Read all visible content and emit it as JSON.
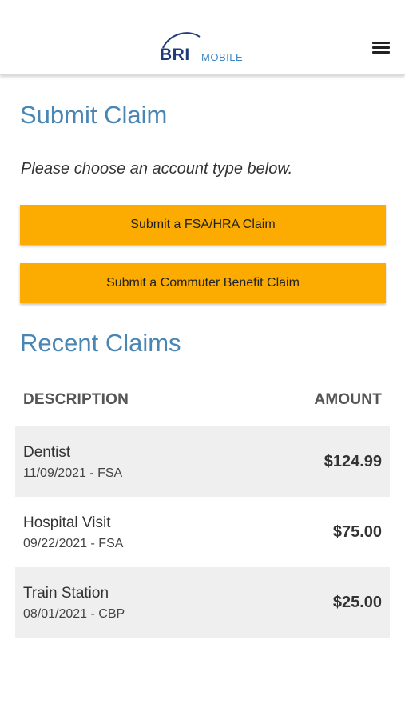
{
  "header": {
    "logo_primary": "BRI",
    "logo_secondary": "MOBILE",
    "menu_icon": "hamburger-menu-icon"
  },
  "submit_section": {
    "title": "Submit Claim",
    "instructions": "Please choose an account type below.",
    "buttons": [
      {
        "label": "Submit a FSA/HRA Claim"
      },
      {
        "label": "Submit a Commuter Benefit Claim"
      }
    ]
  },
  "recent_section": {
    "title": "Recent Claims",
    "columns": {
      "description": "DESCRIPTION",
      "amount": "AMOUNT"
    },
    "claims": [
      {
        "description": "Dentist",
        "meta": "11/09/2021 - FSA",
        "amount": "$124.99"
      },
      {
        "description": "Hospital Visit",
        "meta": "09/22/2021 - FSA",
        "amount": "$75.00"
      },
      {
        "description": "Train Station",
        "meta": "08/01/2021 - CBP",
        "amount": "$25.00"
      }
    ]
  },
  "colors": {
    "title_blue": "#4a86b4",
    "button_orange": "#fcab00",
    "row_shade": "#efefef",
    "logo_navy": "#1f3b7a",
    "logo_light_blue": "#3d87c4"
  }
}
